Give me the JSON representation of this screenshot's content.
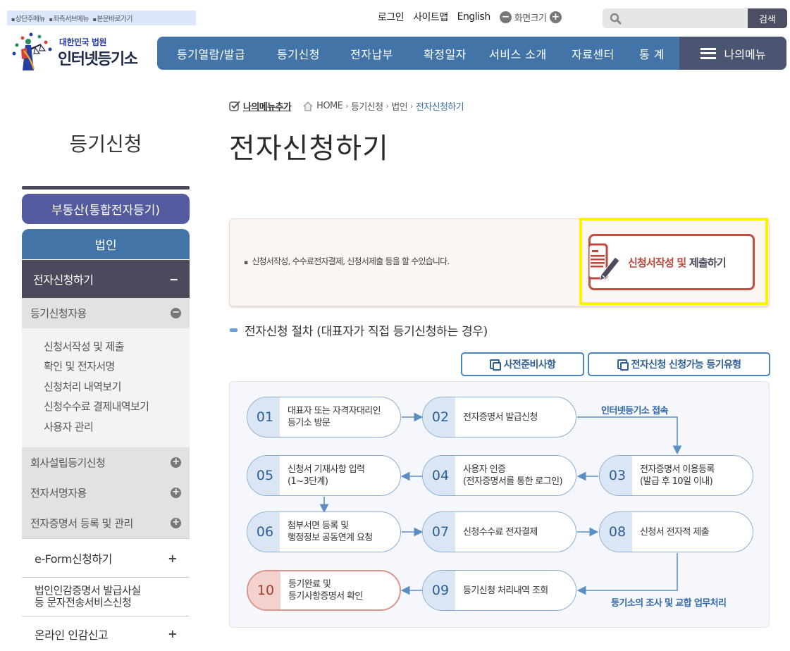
{
  "skip_nav": [
    "상단주메뉴",
    "좌측서브메뉴",
    "본문바로가기"
  ],
  "util": {
    "login": "로그인",
    "sitemap": "사이트맵",
    "english": "English",
    "screen_size": "화면크기",
    "zoom_out_icon": "minus-circle-icon",
    "zoom_in_icon": "plus-circle-icon"
  },
  "search": {
    "placeholder": "",
    "value": "",
    "button": "검색",
    "icon": "search-icon"
  },
  "logo": {
    "line1": "대한민국 법원",
    "line2": "인터넷등기소"
  },
  "gnb": {
    "items": [
      "등기열람/발급",
      "등기신청",
      "전자납부",
      "확정일자",
      "서비스 소개",
      "자료센터",
      "통 계"
    ],
    "my_menu": "나의메뉴"
  },
  "sidebar": {
    "title": "등기신청",
    "realestate": "부동산(통합전자등기)",
    "corporation": "법인",
    "active": {
      "label": "전자신청하기",
      "toggle": "−"
    },
    "groups": [
      {
        "label": "등기신청자용",
        "state": "open",
        "icon": "−"
      },
      {
        "label": "회사설립등기신청",
        "state": "closed",
        "icon": "+"
      },
      {
        "label": "전자서명자용",
        "state": "closed",
        "icon": "+"
      },
      {
        "label": "전자증명서 등록 및 관리",
        "state": "closed",
        "icon": "+"
      }
    ],
    "sub_items": [
      "신청서작성 및 제출",
      "확인 및 전자서명",
      "신청처리 내역보기",
      "신청수수료 결제내역보기",
      "사용자 관리"
    ],
    "main_items": [
      {
        "label": "e-Form신청하기",
        "icon": "+"
      },
      {
        "label": "법인인감증명서 발급사실\n등 문자전송서비스신청",
        "icon": ""
      },
      {
        "label": "온라인 인감신고",
        "icon": "+"
      }
    ]
  },
  "breadcrumb": {
    "add_menu": "나의메뉴추가",
    "items": [
      "HOME",
      "등기신청",
      "법인",
      "전자신청하기"
    ]
  },
  "page_title": "전자신청하기",
  "notice": {
    "text": "신청서작성, 수수료전자결제, 신청서제출 등을 할 수있습니다.",
    "button_part1": "신청서작성 및",
    "button_part2": "제출하기"
  },
  "section_title": "전자신청 절차 (대표자가 직접 등기신청하는 경우)",
  "buttons": {
    "prep": "사전준비사항",
    "types": "전자신청 신청가능 등기유형"
  },
  "flow": {
    "steps": [
      {
        "num": "01",
        "label": "대표자 또는 자격자대리인\n등기소 방문"
      },
      {
        "num": "02",
        "label": "전자증명서 발급신청"
      },
      {
        "num": "03",
        "label": "전자증명서 이용등록\n(발급 후 10일 이내)"
      },
      {
        "num": "04",
        "label": "사용자 인증\n(전자증명서를 통한 로그인)"
      },
      {
        "num": "05",
        "label": "신청서 기재사항 입력\n(1~3단계)"
      },
      {
        "num": "06",
        "label": "첨부서면 등록 및\n행정정보 공동연계 요청"
      },
      {
        "num": "07",
        "label": "신청수수료 전자결제"
      },
      {
        "num": "08",
        "label": "신청서 전자적 제출"
      },
      {
        "num": "09",
        "label": "등기신청 처리내역 조회"
      },
      {
        "num": "10",
        "label": "등기완료 및\n등기사항증명서 확인"
      }
    ],
    "note_top": "인터넷등기소 접속",
    "note_bottom": "등기소의 조사 및  교합 업무처리"
  },
  "colors": {
    "nav_blue": "#4274a7",
    "dark": "#4a4a5c",
    "highlight": "#fff200",
    "accent_red": "#c0453a"
  }
}
